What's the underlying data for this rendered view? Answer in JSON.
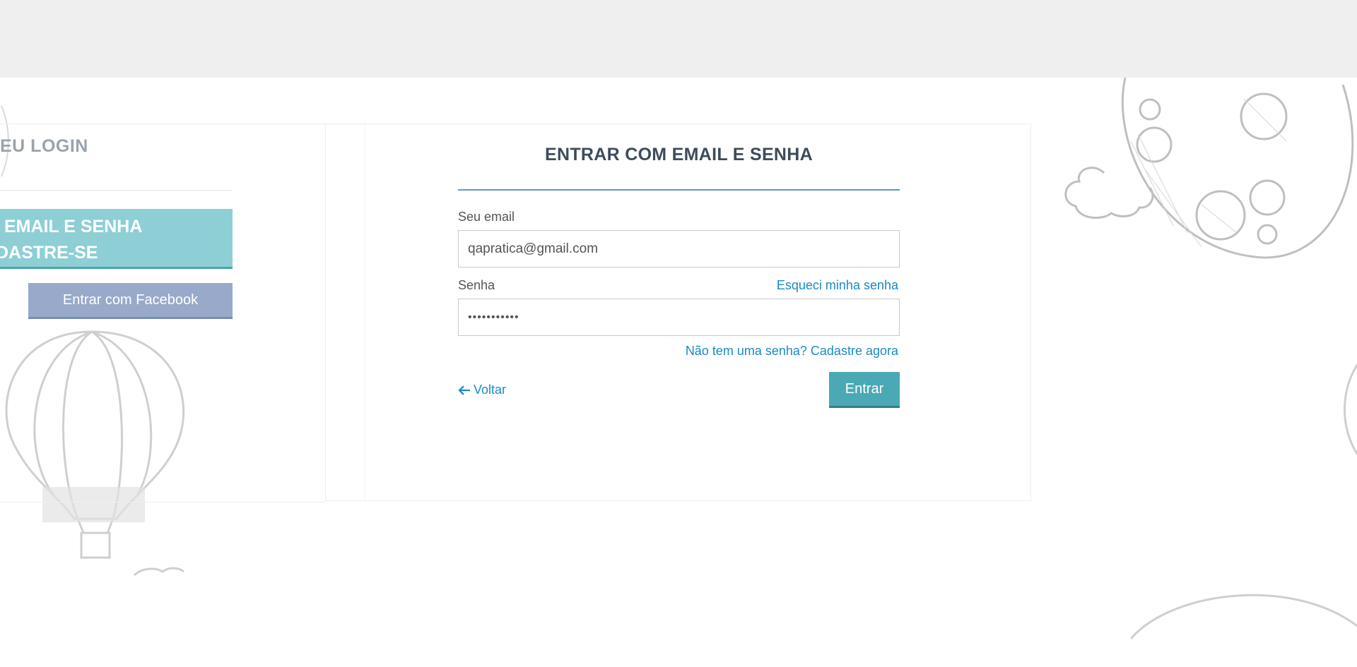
{
  "left_panel": {
    "title": "EU LOGIN",
    "teal_line1": "EMAIL E SENHA",
    "teal_line2": "DASTRE-SE",
    "facebook_label": "Entrar com Facebook"
  },
  "login_card": {
    "title": "ENTRAR COM EMAIL E SENHA",
    "email_label": "Seu email",
    "email_value": "qapratica@gmail.com",
    "password_label": "Senha",
    "password_value": "•••••••••••",
    "forgot_link": "Esqueci minha senha",
    "signup_link": "Não tem uma senha? Cadastre agora",
    "back_link": "Voltar",
    "submit_label": "Entrar"
  },
  "icons": {
    "back": "arrow-left-icon"
  },
  "colors": {
    "teal_button": "#4aa9b4",
    "teal_panel": "#8dcfd5",
    "facebook_button": "#98a9c9",
    "link": "#1a8ac4",
    "title": "#3d4b5c"
  }
}
